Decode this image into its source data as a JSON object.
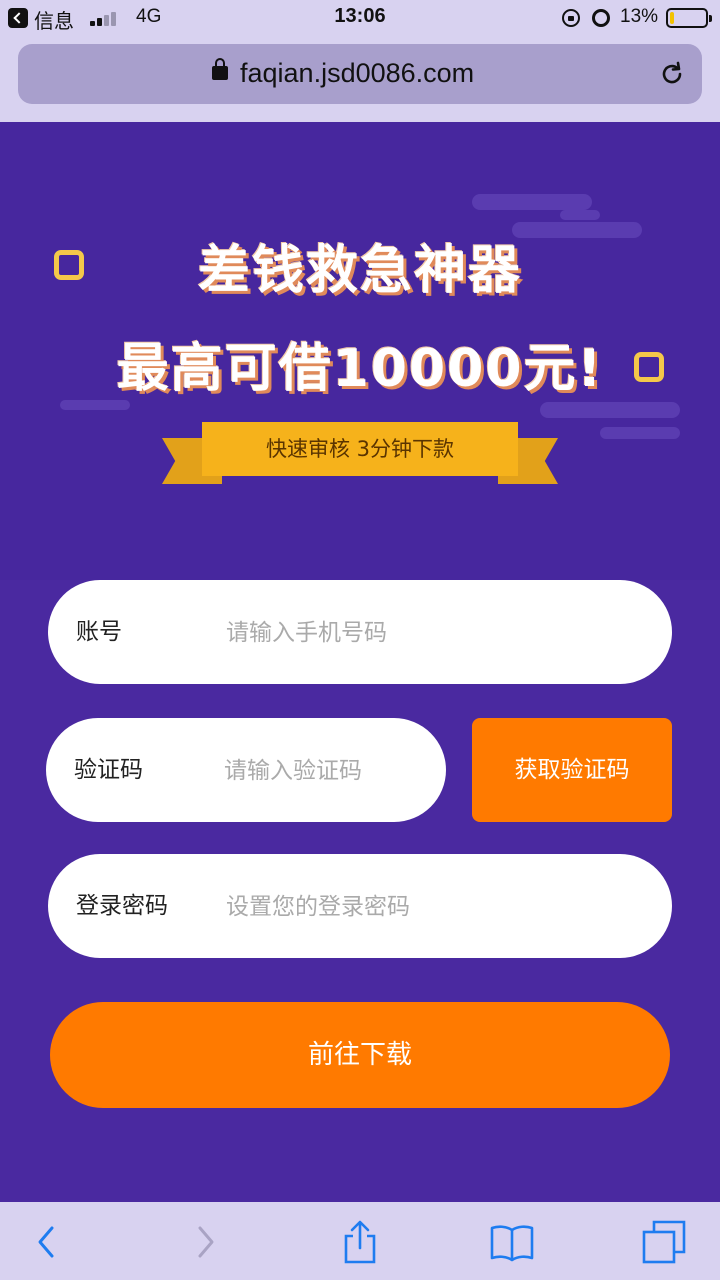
{
  "status_bar": {
    "back_app": "信息",
    "network": "4G",
    "time": "13:06",
    "battery_percent": "13%",
    "battery_level": 0.13,
    "signal_bars_filled": 2,
    "signal_bars_total": 4,
    "icons": [
      "back-app-icon",
      "signal-icon",
      "orientation-lock-icon",
      "alarm-icon",
      "battery-icon"
    ]
  },
  "browser": {
    "url": "faqian.jsd0086.com",
    "icons": [
      "lock-icon",
      "reload-icon"
    ]
  },
  "hero": {
    "title_line1": "差钱救急神器",
    "title_line2": "最高可借10000元!",
    "ribbon_text": "快速审核  3分钟下款"
  },
  "form": {
    "account": {
      "label": "账号",
      "placeholder": "请输入手机号码",
      "value": ""
    },
    "code": {
      "label": "验证码",
      "placeholder": "请输入验证码",
      "value": ""
    },
    "get_code_label": "获取验证码",
    "password": {
      "label": "登录密码",
      "placeholder": "设置您的登录密码",
      "value": ""
    },
    "submit_label": "前往下载"
  },
  "toolbar": {
    "icons": [
      "back-arrow-icon",
      "forward-arrow-icon",
      "share-icon",
      "bookmarks-icon",
      "tabs-icon"
    ]
  },
  "colors": {
    "background": "#4a29a0",
    "accent": "#ff7a00",
    "ribbon": "#f6b21b",
    "browser_chrome": "#d8d2f0"
  }
}
